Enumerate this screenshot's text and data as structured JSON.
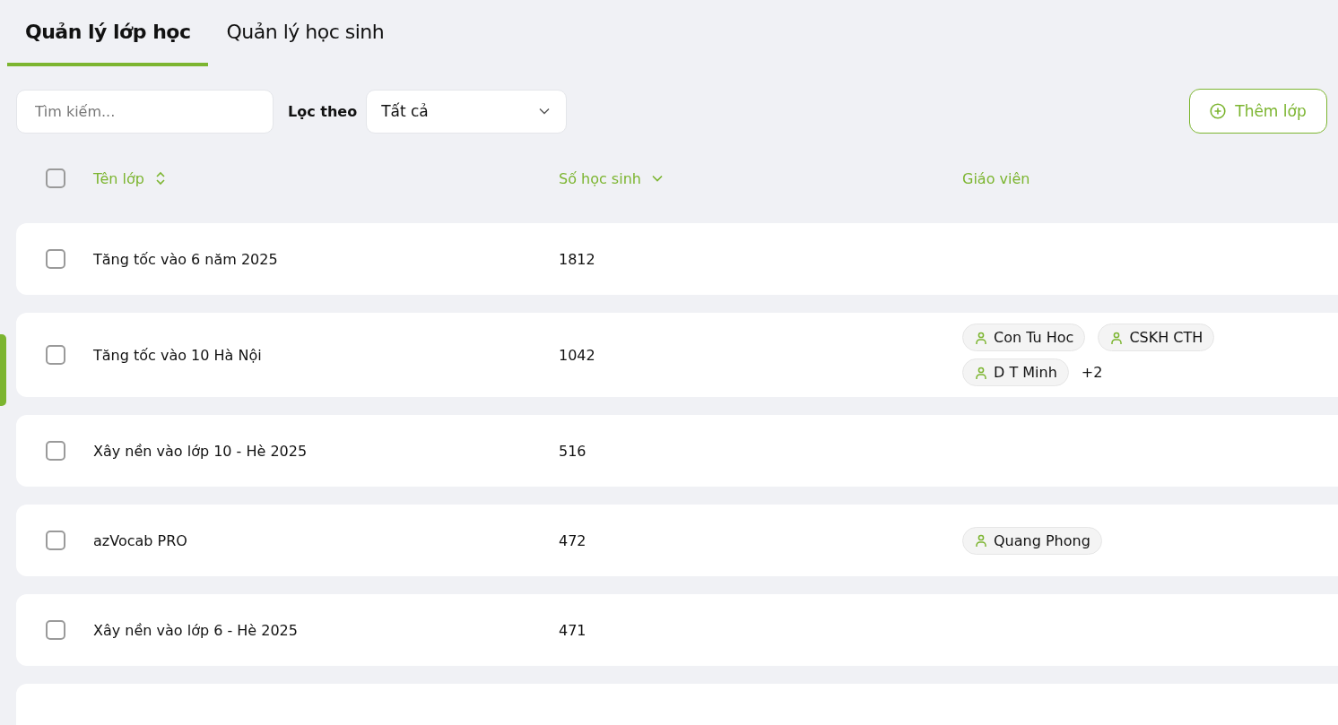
{
  "tabs": [
    {
      "label": "Quản lý lớp học",
      "selected": true
    },
    {
      "label": "Quản lý học sinh",
      "selected": false
    }
  ],
  "toolbar": {
    "search": {
      "placeholder": "Tìm kiếm..."
    },
    "filter_label": "Lọc theo",
    "filter": {
      "value": "Tất cả"
    },
    "add_button": "Thêm lớp"
  },
  "table": {
    "select_all": {
      "checked": false
    },
    "columns": [
      {
        "label": "Tên lớp",
        "kind": "sortable"
      },
      {
        "label": "Số học sinh",
        "kind": "sorted"
      },
      {
        "label": "Giáo viên",
        "kind": "plain"
      }
    ],
    "rows": [
      {
        "checked": false,
        "name": "Tăng tốc vào 6 năm 2025",
        "students": "1812",
        "teachers": []
      },
      {
        "checked": false,
        "name": "Tăng tốc vào 10 Hà Nội",
        "students": "1042",
        "teachers": [
          "Con Tu Hoc",
          "CSKH CTH",
          "D T Minh"
        ],
        "more": "+2"
      },
      {
        "checked": false,
        "name": "Xây nền vào lớp 10 - Hè 2025",
        "students": "516",
        "teachers": []
      },
      {
        "checked": false,
        "name": "azVocab PRO",
        "students": "472",
        "teachers": [
          "Quang Phong"
        ]
      },
      {
        "checked": false,
        "name": "Xây nền vào lớp 6 - Hè 2025",
        "students": "471",
        "teachers": []
      }
    ]
  }
}
